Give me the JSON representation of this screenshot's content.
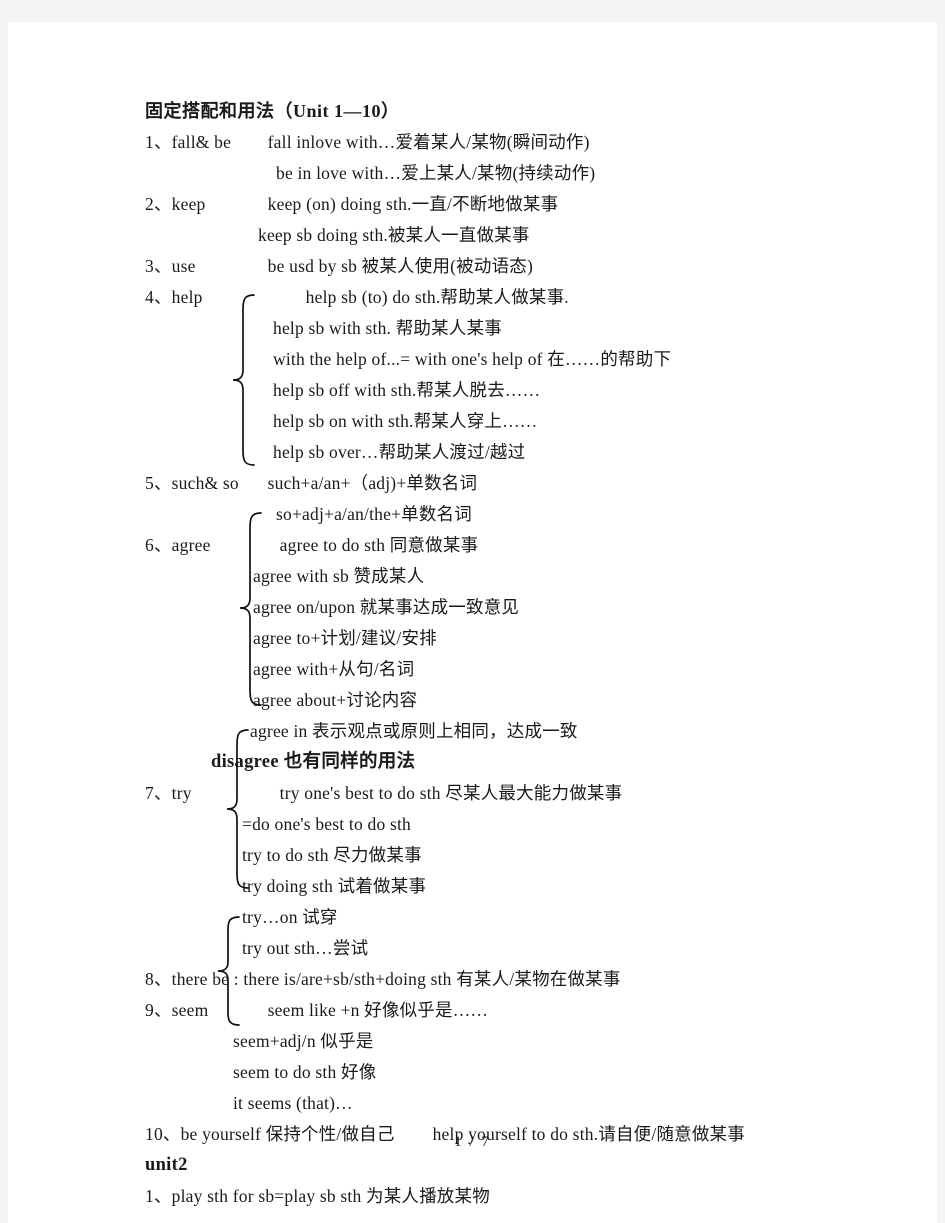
{
  "document": {
    "title": "固定搭配和用法（Unit 1—10）",
    "footer": "1 / 7",
    "unit2_heading": "unit2"
  },
  "entries": [
    {
      "number": "1、",
      "keyword": "fall& be",
      "lines": [
        "fall inlove with…爱着某人/某物(瞬间动作)",
        "be in love with…爱上某人/某物(持续动作)"
      ]
    },
    {
      "number": "2、",
      "keyword": "keep",
      "lines": [
        "keep (on) doing sth.一直/不断地做某事",
        "keep sb doing sth.被某人一直做某事"
      ]
    },
    {
      "number": "3、",
      "keyword": "use",
      "lines": [
        "be usd by sb  被某人使用(被动语态)"
      ]
    },
    {
      "number": "4、",
      "keyword": "help",
      "braced": true,
      "lines": [
        "help sb (to) do sth.帮助某人做某事.",
        "help sb with sth.  帮助某人某事",
        "with the help of...= with one's help of 在……的帮助下",
        "help sb off with sth.帮某人脱去……",
        "help sb on with sth.帮某人穿上……",
        "help sb over…帮助某人渡过/越过"
      ]
    },
    {
      "number": "5、",
      "keyword": "such& so",
      "lines": [
        "such+a/an+（adj)+单数名词",
        "so+adj+a/an/the+单数名词"
      ]
    },
    {
      "number": "6、",
      "keyword": "agree",
      "braced": true,
      "lines": [
        "agree to do sth  同意做某事",
        "agree with sb  赞成某人",
        "agree on/upon  就某事达成一致意见",
        "agree to+计划/建议/安排",
        "agree with+从句/名词",
        "agree about+讨论内容",
        "agree in  表示观点或原则上相同，达成一致"
      ],
      "note": "disagree   也有同样的用法"
    },
    {
      "number": "7、",
      "keyword": "try",
      "braced": true,
      "lines": [
        "try one's best to do sth  尽某人最大能力做某事",
        "=do one's best to do sth",
        "try to do sth  尽力做某事",
        "try doing sth  试着做某事",
        "try…on  试穿",
        "try out sth…尝试"
      ]
    },
    {
      "number": "8、",
      "keyword": "there be :",
      "lines": [
        "there is/are+sb/sth+doing sth 有某人/某物在做某事"
      ]
    },
    {
      "number": "9、",
      "keyword": "seem",
      "braced": true,
      "lines": [
        "seem like +n  好像似乎是……",
        "seem+adj/n    似乎是",
        "seem to do sth  好像",
        "it seems (that)…"
      ]
    },
    {
      "number": "10、",
      "keyword": "be yourself",
      "lines": [
        "保持个性/做自己",
        "help yourself to do sth.请自便/随意做某事"
      ]
    }
  ],
  "unit2_entries": [
    {
      "number": "1、",
      "text": "play sth for sb=play sb sth  为某人播放某物"
    }
  ]
}
